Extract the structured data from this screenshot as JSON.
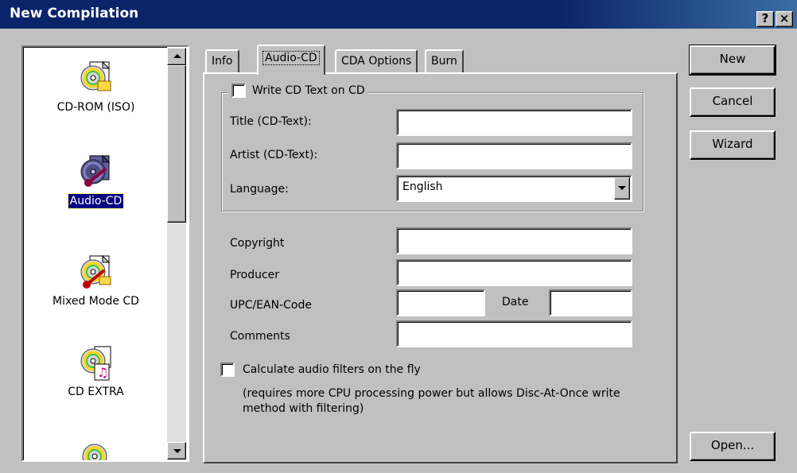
{
  "window": {
    "title": "New Compilation",
    "help_label": "?",
    "close_label": "×"
  },
  "compilation_types": [
    {
      "label": "CD-ROM (ISO)",
      "icon": "cd-rom-iso-icon",
      "selected": false
    },
    {
      "label": "Audio-CD",
      "icon": "audio-cd-icon",
      "selected": true
    },
    {
      "label": "Mixed Mode CD",
      "icon": "mixed-mode-cd-icon",
      "selected": false
    },
    {
      "label": "CD EXTRA",
      "icon": "cd-extra-icon",
      "selected": false
    },
    {
      "label": "",
      "icon": "cd-icon",
      "selected": false
    }
  ],
  "tabs": [
    {
      "label": "Info",
      "active": false
    },
    {
      "label": "Audio-CD",
      "active": true
    },
    {
      "label": "CDA Options",
      "active": false
    },
    {
      "label": "Burn",
      "active": false
    }
  ],
  "audio_cd": {
    "write_cd_text_label": "Write CD Text on CD",
    "write_cd_text_checked": false,
    "title_label": "Title (CD-Text):",
    "title_value": "",
    "artist_label": "Artist (CD-Text):",
    "artist_value": "",
    "language_label": "Language:",
    "language_value": "English",
    "copyright_label": "Copyright",
    "copyright_value": "",
    "producer_label": "Producer",
    "producer_value": "",
    "upc_label": "UPC/EAN-Code",
    "upc_value": "",
    "date_label": "Date",
    "date_value": "",
    "comments_label": "Comments",
    "comments_value": "",
    "calc_filters_label": "Calculate audio filters on the fly",
    "calc_filters_checked": false,
    "calc_filters_note": "(requires more CPU processing power but allows Disc-At-Once write method with filtering)"
  },
  "buttons": {
    "new_label": "New",
    "cancel_label": "Cancel",
    "wizard_label": "Wizard",
    "open_label": "Open..."
  },
  "colors": {
    "titlebar": "#0a246a",
    "face": "#c0c0c0",
    "selection": "#000080"
  }
}
